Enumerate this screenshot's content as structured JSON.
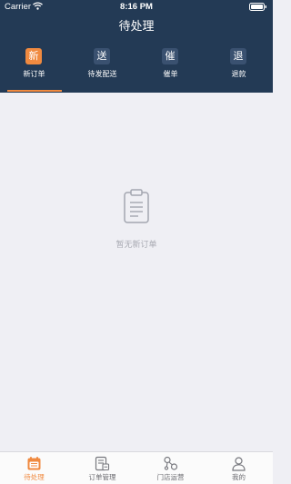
{
  "status_bar": {
    "carrier": "Carrier",
    "time": "8:16 PM"
  },
  "nav": {
    "title": "待处理"
  },
  "tabs": [
    {
      "badge": "新",
      "label": "新订单",
      "active": true
    },
    {
      "badge": "送",
      "label": "待发配送",
      "active": false
    },
    {
      "badge": "催",
      "label": "催单",
      "active": false
    },
    {
      "badge": "退",
      "label": "退款",
      "active": false
    }
  ],
  "empty_state": {
    "icon": "clipboard-icon",
    "text": "暂无新订单"
  },
  "tabbar": [
    {
      "label": "待处理",
      "icon": "calendar-icon",
      "active": true
    },
    {
      "label": "订单管理",
      "icon": "order-list-icon",
      "active": false
    },
    {
      "label": "门店运营",
      "icon": "store-operations-icon",
      "active": false
    },
    {
      "label": "我的",
      "icon": "profile-icon",
      "active": false
    }
  ],
  "colors": {
    "header_bg": "#233a55",
    "accent": "#f08a40",
    "page_bg": "#efeff4"
  }
}
